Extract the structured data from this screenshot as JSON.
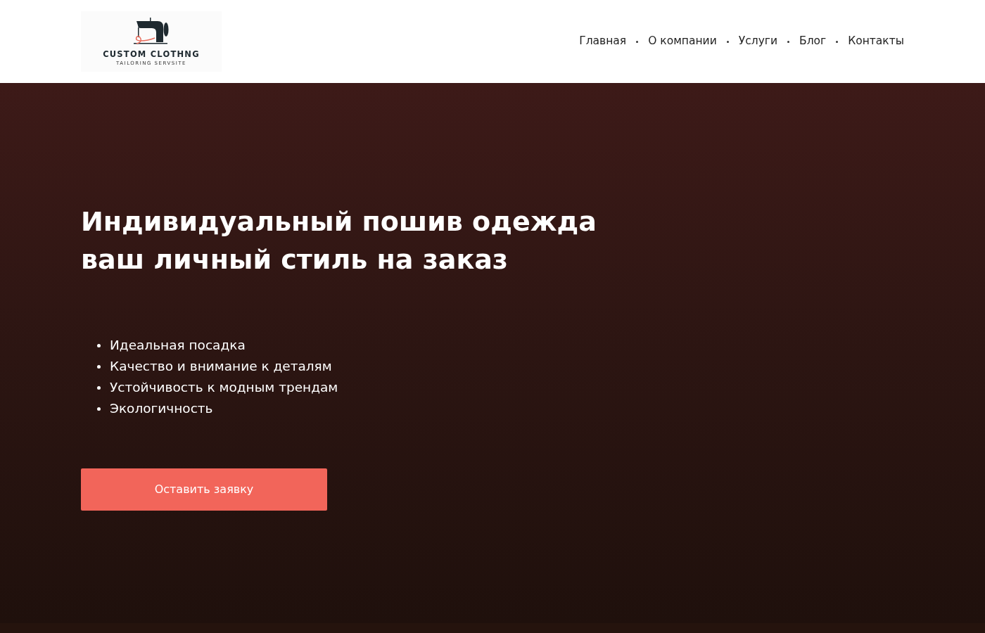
{
  "logo": {
    "title": "CUSTOM CLOTHNG",
    "subtitle": "TAILORING SERVSITE"
  },
  "nav": [
    {
      "label": "Главная"
    },
    {
      "label": "О компании"
    },
    {
      "label": "Услуги"
    },
    {
      "label": "Блог"
    },
    {
      "label": "Контакты"
    }
  ],
  "hero": {
    "heading_lines": [
      "Индивидуальный пошив одежда",
      "ваш личный стиль на заказ"
    ],
    "features": [
      "Идеальная посадка",
      "Качество и внимание к деталям",
      "Устойчивость к модным трендам",
      "Экологичность"
    ],
    "button": "Оставить заявку"
  }
}
